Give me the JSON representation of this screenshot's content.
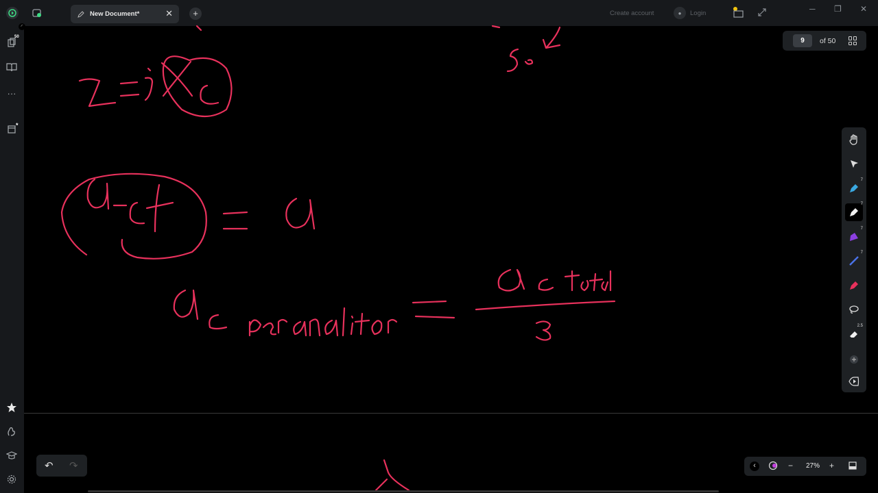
{
  "titlebar": {
    "tab_title": "New Document*",
    "tab_close": "✕",
    "new_tab": "+",
    "create_account": "Create account",
    "login": "Login",
    "minimize": "─",
    "restore": "❐",
    "close": "✕"
  },
  "rail": {
    "pages_badge": "50",
    "more": "···",
    "notes_badge": "*"
  },
  "pager": {
    "current": "9",
    "total": "of 50"
  },
  "toolbar": {
    "badges": [
      "7",
      "7",
      "7",
      "7",
      "2.5"
    ]
  },
  "undo": {
    "undo": "↶",
    "redo": "↷"
  },
  "zoom": {
    "prev": "‹",
    "minus": "−",
    "level": "27%",
    "plus": "+"
  },
  "colors": {
    "ink": "#e8315c",
    "background": "#000000",
    "panel": "#1e2124",
    "titlebar": "#17191c"
  }
}
